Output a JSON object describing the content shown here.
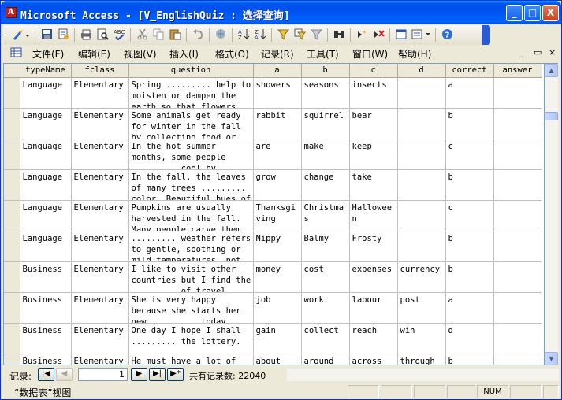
{
  "window": {
    "title": "Microsoft Access - [V_EnglishQuiz : 选择查询]",
    "app_icon_letter": "A",
    "controls": {
      "minimize": "_",
      "maximize": "□",
      "close": "X"
    }
  },
  "toolbar": {
    "icons": [
      "design-view-icon",
      "save-icon",
      "print-setup-icon",
      "print-icon",
      "print-preview-icon",
      "spelling-icon",
      "cut-icon",
      "copy-icon",
      "paste-icon",
      "undo-icon",
      "hyperlink-icon",
      "sort-ascending-icon",
      "sort-descending-icon",
      "filter-by-selection-icon",
      "filter-by-form-icon",
      "apply-filter-icon",
      "find-icon",
      "new-record-icon",
      "delete-record-icon",
      "database-window-icon",
      "new-object-icon",
      "help-icon"
    ]
  },
  "menu": {
    "items": [
      "文件(F)",
      "编辑(E)",
      "视图(V)",
      "插入(I)",
      "格式(O)",
      "记录(R)",
      "工具(T)",
      "窗口(W)",
      "帮助(H)"
    ],
    "mdi_controls": [
      "_",
      "▭",
      "×"
    ]
  },
  "table": {
    "columns": [
      "typeName",
      "fclass",
      "question",
      "a",
      "b",
      "c",
      "d",
      "correct",
      "answer"
    ],
    "rows": [
      [
        "Language",
        "Elementary",
        "Spring ......... help to moisten or dampen the earth so that flowers",
        "showers",
        "seasons",
        "insects",
        "",
        "a",
        ""
      ],
      [
        "Language",
        "Elementary",
        "Some animals get ready for winter in the fall by collecting food or",
        "rabbit",
        "squirrel",
        "bear",
        "",
        "b",
        ""
      ],
      [
        "Language",
        "Elementary",
        "In the hot summer months, some people ......... cool by",
        "are",
        "make",
        "keep",
        "",
        "c",
        ""
      ],
      [
        "Language",
        "Elementary",
        "In the fall, the leaves of many trees ......... color. Beautiful hues of",
        "grow",
        "change",
        "take",
        "",
        "b",
        ""
      ],
      [
        "Language",
        "Elementary",
        "Pumpkins are usually harvested in the fall. Many people carve them",
        "Thanksgiving",
        "Christmas",
        "Halloween",
        "",
        "c",
        ""
      ],
      [
        "Language",
        "Elementary",
        "......... weather refers to gentle, soothing or mild temperatures, not",
        "Nippy",
        "Balmy",
        "Frosty",
        "",
        "b",
        ""
      ],
      [
        "Business",
        "Elementary",
        "I like to visit other countries but I find the ......... of travel",
        "money",
        "cost",
        "expenses",
        "currency",
        "b",
        ""
      ],
      [
        "Business",
        "Elementary",
        "She is very happy because she starts her new ......... today.",
        "job",
        "work",
        "labour",
        "post",
        "a",
        ""
      ],
      [
        "Business",
        "Elementary",
        "One day I hope I shall ......... the lottery.",
        "gain",
        "collect",
        "reach",
        "win",
        "d",
        ""
      ],
      [
        "Business",
        "Elementary",
        "He must have a lot of",
        "about",
        "around",
        "across",
        "through",
        "b",
        ""
      ]
    ]
  },
  "navigation": {
    "label": "记录:",
    "current_record": "1",
    "total_label": "共有记录数: 22040",
    "buttons": [
      "|◀",
      "◀",
      "▶",
      "▶|",
      "▶*"
    ]
  },
  "status": {
    "text": "“数据表”视图",
    "num": "NUM"
  }
}
